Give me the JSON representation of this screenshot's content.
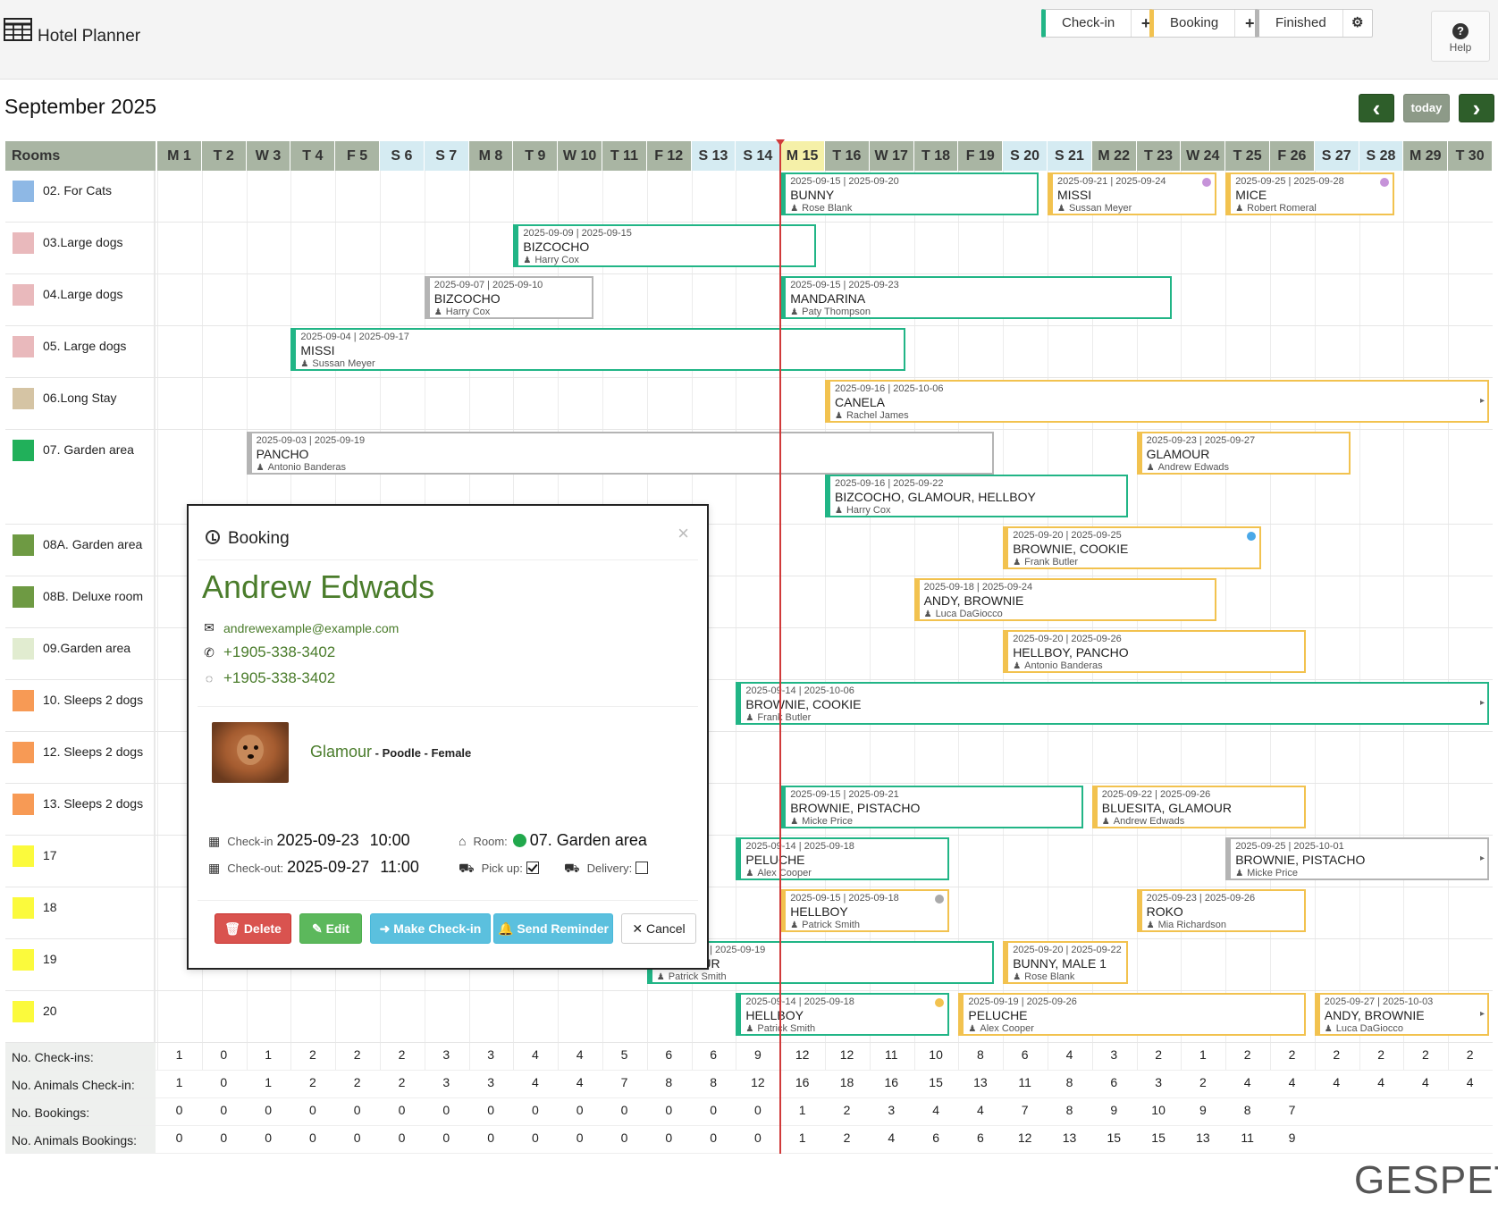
{
  "app": {
    "title": "Hotel Planner"
  },
  "legend": {
    "checkin": {
      "label": "Check-in",
      "action": "+"
    },
    "booking": {
      "label": "Booking",
      "action": "+"
    },
    "finished": {
      "label": "Finished",
      "action": "⚙"
    }
  },
  "help": {
    "label": "Help",
    "icon": "?"
  },
  "calendar": {
    "month": "September 2025",
    "today_label": "today",
    "prev_icon": "‹",
    "next_icon": "›",
    "rooms_header": "Rooms",
    "today_day_index": 14,
    "days": [
      {
        "label": "M 1",
        "type": "weekday"
      },
      {
        "label": "T 2",
        "type": "weekday"
      },
      {
        "label": "W 3",
        "type": "weekday"
      },
      {
        "label": "T 4",
        "type": "weekday"
      },
      {
        "label": "F 5",
        "type": "weekday"
      },
      {
        "label": "S 6",
        "type": "weekend"
      },
      {
        "label": "S 7",
        "type": "weekend"
      },
      {
        "label": "M 8",
        "type": "weekday"
      },
      {
        "label": "T 9",
        "type": "weekday"
      },
      {
        "label": "W 10",
        "type": "weekday"
      },
      {
        "label": "T 11",
        "type": "weekday"
      },
      {
        "label": "F 12",
        "type": "weekday"
      },
      {
        "label": "S 13",
        "type": "weekend"
      },
      {
        "label": "S 14",
        "type": "weekend"
      },
      {
        "label": "M 15",
        "type": "today"
      },
      {
        "label": "T 16",
        "type": "weekday"
      },
      {
        "label": "W 17",
        "type": "weekday"
      },
      {
        "label": "T 18",
        "type": "weekday"
      },
      {
        "label": "F 19",
        "type": "weekday"
      },
      {
        "label": "S 20",
        "type": "weekend"
      },
      {
        "label": "S 21",
        "type": "weekend"
      },
      {
        "label": "M 22",
        "type": "weekday"
      },
      {
        "label": "T 23",
        "type": "weekday"
      },
      {
        "label": "W 24",
        "type": "weekday"
      },
      {
        "label": "T 25",
        "type": "weekday"
      },
      {
        "label": "F 26",
        "type": "weekday"
      },
      {
        "label": "S 27",
        "type": "weekend"
      },
      {
        "label": "S 28",
        "type": "weekend"
      },
      {
        "label": "M 29",
        "type": "weekday"
      },
      {
        "label": "T 30",
        "type": "weekday"
      }
    ]
  },
  "colors": {
    "checkin": "#21b586",
    "booking": "#f2c24f",
    "finished": "#b4b4b4",
    "weekday_header": "#a9b5a3",
    "weekend_header": "#d5ebf2",
    "today_header": "#f5f0a8",
    "today_line": "#d03a3a",
    "nav_button": "#2e5e2a",
    "today_button": "#8d9a88"
  },
  "rooms": [
    {
      "name": "02. For Cats",
      "color": "#8eb8e5",
      "tall": false
    },
    {
      "name": "03.Large dogs",
      "color": "#e9b9bc",
      "tall": false
    },
    {
      "name": "04.Large dogs",
      "color": "#e9b9bc",
      "tall": false
    },
    {
      "name": "05. Large dogs",
      "color": "#e9b9bc",
      "tall": false
    },
    {
      "name": "06.Long Stay",
      "color": "#d5c4a4",
      "tall": false
    },
    {
      "name": "07. Garden area",
      "color": "#21b05a",
      "tall": true
    },
    {
      "name": "08A. Garden area",
      "color": "#6e9a43",
      "tall": false
    },
    {
      "name": "08B. Deluxe room",
      "color": "#6e9a43",
      "tall": false
    },
    {
      "name": "09.Garden area",
      "color": "#e1ecd0",
      "tall": false
    },
    {
      "name": "10. Sleeps 2 dogs",
      "color": "#f79a55",
      "tall": false
    },
    {
      "name": "12. Sleeps 2 dogs",
      "color": "#f79a55",
      "tall": false
    },
    {
      "name": "13. Sleeps 2 dogs",
      "color": "#f79a55",
      "tall": false
    },
    {
      "name": "17",
      "color": "#fbfa3c",
      "tall": false
    },
    {
      "name": "18",
      "color": "#fbfa3c",
      "tall": false
    },
    {
      "name": "19",
      "color": "#fbfa3c",
      "tall": false
    },
    {
      "name": "20",
      "color": "#fbfa3c",
      "tall": false
    }
  ],
  "bookings": [
    {
      "room": 0,
      "lane": 0,
      "start": 15,
      "end": 20,
      "status": "checkin",
      "dates": "2025-09-15 | 2025-09-20",
      "pets": "BUNNY",
      "owner": "Rose Blank"
    },
    {
      "room": 0,
      "lane": 0,
      "start": 21,
      "end": 24,
      "status": "booking",
      "dates": "2025-09-21 | 2025-09-24",
      "pets": "MISSI",
      "owner": "Sussan Meyer",
      "dot": "#c693d9"
    },
    {
      "room": 0,
      "lane": 0,
      "start": 25,
      "end": 28,
      "status": "booking",
      "dates": "2025-09-25 | 2025-09-28",
      "pets": "MICE",
      "owner": "Robert Romeral",
      "dot": "#c693d9"
    },
    {
      "room": 1,
      "lane": 0,
      "start": 9,
      "end": 15,
      "status": "checkin",
      "dates": "2025-09-09 | 2025-09-15",
      "pets": "BIZCOCHO",
      "owner": "Harry Cox"
    },
    {
      "room": 2,
      "lane": 0,
      "start": 7,
      "end": 10,
      "status": "finished",
      "dates": "2025-09-07 | 2025-09-10",
      "pets": "BIZCOCHO",
      "owner": "Harry Cox"
    },
    {
      "room": 2,
      "lane": 0,
      "start": 15,
      "end": 23,
      "status": "checkin",
      "dates": "2025-09-15 | 2025-09-23",
      "pets": "MANDARINA",
      "owner": "Paty Thompson"
    },
    {
      "room": 3,
      "lane": 0,
      "start": 4,
      "end": 17,
      "status": "checkin",
      "dates": "2025-09-04 | 2025-09-17",
      "pets": "MISSI",
      "owner": "Sussan Meyer"
    },
    {
      "room": 4,
      "lane": 0,
      "start": 16,
      "end": 31,
      "status": "booking",
      "dates": "2025-09-16 | 2025-10-06",
      "pets": "CANELA",
      "owner": "Rachel James",
      "more": true
    },
    {
      "room": 5,
      "lane": 0,
      "start": 3,
      "end": 19,
      "status": "finished",
      "dates": "2025-09-03 | 2025-09-19",
      "pets": "PANCHO",
      "owner": "Antonio Banderas"
    },
    {
      "room": 5,
      "lane": 0,
      "start": 23,
      "end": 27,
      "status": "booking",
      "dates": "2025-09-23 | 2025-09-27",
      "pets": "GLAMOUR",
      "owner": "Andrew Edwads"
    },
    {
      "room": 5,
      "lane": 1,
      "start": 16,
      "end": 22,
      "status": "checkin",
      "dates": "2025-09-16 | 2025-09-22",
      "pets": "BIZCOCHO, GLAMOUR, HELLBOY",
      "owner": "Harry Cox"
    },
    {
      "room": 6,
      "lane": 0,
      "start": 20,
      "end": 25,
      "status": "booking",
      "dates": "2025-09-20 | 2025-09-25",
      "pets": "BROWNIE, COOKIE",
      "owner": "Frank Butler",
      "dot": "#4aa8e8"
    },
    {
      "room": 7,
      "lane": 0,
      "start": 18,
      "end": 24,
      "status": "booking",
      "dates": "2025-09-18 | 2025-09-24",
      "pets": "ANDY, BROWNIE",
      "owner": "Luca DaGiocco"
    },
    {
      "room": 8,
      "lane": 0,
      "start": 20,
      "end": 26,
      "status": "booking",
      "dates": "2025-09-20 | 2025-09-26",
      "pets": "HELLBOY, PANCHO",
      "owner": "Antonio Banderas"
    },
    {
      "room": 9,
      "lane": 0,
      "start": 14,
      "end": 31,
      "status": "checkin",
      "dates": "2025-09-14 | 2025-10-06",
      "pets": "BROWNIE, COOKIE",
      "owner": "Frank Butler",
      "more": true
    },
    {
      "room": 11,
      "lane": 0,
      "start": 15,
      "end": 21,
      "status": "checkin",
      "dates": "2025-09-15 | 2025-09-21",
      "pets": "BROWNIE, PISTACHO",
      "owner": "Micke Price"
    },
    {
      "room": 11,
      "lane": 0,
      "start": 22,
      "end": 26,
      "status": "booking",
      "dates": "2025-09-22 | 2025-09-26",
      "pets": "BLUESITA, GLAMOUR",
      "owner": "Andrew Edwads"
    },
    {
      "room": 12,
      "lane": 0,
      "start": 14,
      "end": 18,
      "status": "checkin",
      "dates": "2025-09-14 | 2025-09-18",
      "pets": "PELUCHE",
      "owner": "Alex Cooper"
    },
    {
      "room": 12,
      "lane": 0,
      "start": 25,
      "end": 31,
      "status": "finished",
      "dates": "2025-09-25 | 2025-10-01",
      "pets": "BROWNIE, PISTACHO",
      "owner": "Micke Price",
      "more": true
    },
    {
      "room": 13,
      "lane": 0,
      "start": 15,
      "end": 18,
      "status": "booking",
      "dates": "2025-09-15 | 2025-09-18",
      "pets": "HELLBOY",
      "owner": "Patrick Smith",
      "dot": "#aaaaaa"
    },
    {
      "room": 13,
      "lane": 0,
      "start": 23,
      "end": 26,
      "status": "booking",
      "dates": "2025-09-23 | 2025-09-26",
      "pets": "ROKO",
      "owner": "Mia Richardson"
    },
    {
      "room": 14,
      "lane": 0,
      "start": 12,
      "end": 19,
      "status": "checkin",
      "dates": "2025-09-12 | 2025-09-19",
      "pets": "GLAMOUR",
      "owner": "Patrick Smith"
    },
    {
      "room": 14,
      "lane": 0,
      "start": 20,
      "end": 22,
      "status": "booking",
      "dates": "2025-09-20 | 2025-09-22",
      "pets": "BUNNY, MALE 1",
      "owner": "Rose Blank"
    },
    {
      "room": 15,
      "lane": 0,
      "start": 14,
      "end": 18,
      "status": "checkin",
      "dates": "2025-09-14 | 2025-09-18",
      "pets": "HELLBOY",
      "owner": "Patrick Smith",
      "dot": "#f2c24f"
    },
    {
      "room": 15,
      "lane": 0,
      "start": 19,
      "end": 26,
      "status": "booking",
      "dates": "2025-09-19 | 2025-09-26",
      "pets": "PELUCHE",
      "owner": "Alex Cooper"
    },
    {
      "room": 15,
      "lane": 0,
      "start": 27,
      "end": 31,
      "status": "booking",
      "dates": "2025-09-27 | 2025-10-03",
      "pets": "ANDY, BROWNIE",
      "owner": "Luca DaGiocco",
      "more": true
    }
  ],
  "stats": [
    {
      "label": "No. Check-ins:",
      "values": [
        "1",
        "0",
        "1",
        "2",
        "2",
        "2",
        "3",
        "3",
        "4",
        "4",
        "5",
        "6",
        "6",
        "9",
        "12",
        "12",
        "11",
        "10",
        "8",
        "6",
        "4",
        "3",
        "2",
        "1",
        "2",
        "2",
        "2",
        "2",
        "2",
        "2"
      ]
    },
    {
      "label": "No. Animals Check-in:",
      "values": [
        "1",
        "0",
        "1",
        "2",
        "2",
        "2",
        "3",
        "3",
        "4",
        "4",
        "7",
        "8",
        "8",
        "12",
        "16",
        "18",
        "16",
        "15",
        "13",
        "11",
        "8",
        "6",
        "3",
        "2",
        "4",
        "4",
        "4",
        "4",
        "4",
        "4"
      ]
    },
    {
      "label": "No. Bookings:",
      "values": [
        "0",
        "0",
        "0",
        "0",
        "0",
        "0",
        "0",
        "0",
        "0",
        "0",
        "0",
        "0",
        "0",
        "0",
        "1",
        "2",
        "3",
        "4",
        "4",
        "7",
        "8",
        "9",
        "10",
        "9",
        "8",
        "7",
        "",
        "",
        "",
        ""
      ]
    },
    {
      "label": "No. Animals Bookings:",
      "values": [
        "0",
        "0",
        "0",
        "0",
        "0",
        "0",
        "0",
        "0",
        "0",
        "0",
        "0",
        "0",
        "0",
        "0",
        "1",
        "2",
        "4",
        "6",
        "6",
        "12",
        "13",
        "15",
        "15",
        "13",
        "11",
        "9",
        "",
        "",
        "",
        ""
      ]
    }
  ],
  "brand": {
    "logo_text": "GESPET"
  },
  "modal": {
    "title": "Booking",
    "close": "×",
    "client_name": "Andrew Edwads",
    "email": "andrewexample@example.com",
    "phone": "+1905-338-3402",
    "whatsapp": "+1905-338-3402",
    "pet": {
      "name": "Glamour",
      "details": " - Poodle - Female"
    },
    "checkin": {
      "label": "Check-in",
      "date": "2025-09-23",
      "time": "10:00"
    },
    "checkout": {
      "label": "Check-out:",
      "date": "2025-09-27",
      "time": "11:00"
    },
    "room": {
      "label": "Room:",
      "value": "07. Garden area"
    },
    "pickup": {
      "label": "Pick up:",
      "checked": true
    },
    "delivery": {
      "label": "Delivery:",
      "checked": false
    },
    "buttons": {
      "delete": "Delete",
      "edit": "Edit",
      "make_checkin": "Make Check-in",
      "send_reminder": "Send Reminder",
      "cancel": "Cancel"
    }
  }
}
